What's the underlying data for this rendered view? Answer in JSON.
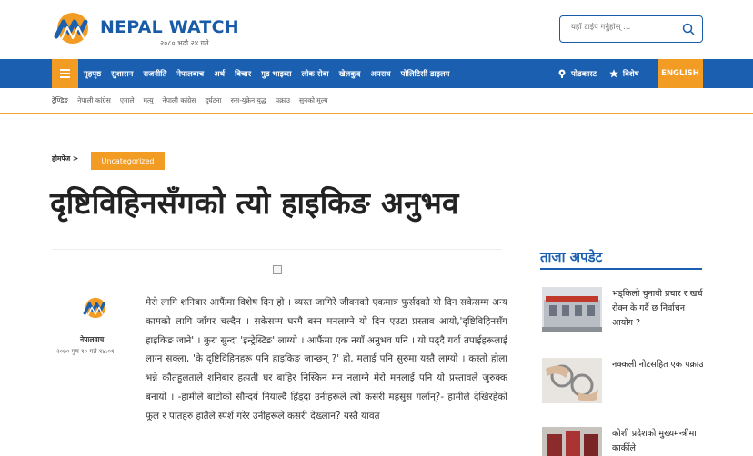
{
  "header": {
    "logo_text": "NEPAL WATCH",
    "date": "२०८० भदौ २४ गते",
    "search_placeholder": "यहाँ टाईप गर्नुहोस् ...",
    "colors": {
      "brand_blue": "#1b5fb0",
      "accent_orange": "#f39c24"
    }
  },
  "nav": {
    "items": [
      "गृहपृष्ठ",
      "सुशासन",
      "राजनीति",
      "नेपालवाच",
      "अर्थ",
      "विचार",
      "गुड भाइब्स",
      "लोक सेवा",
      "खेलकुद",
      "अपराध",
      "पोलिटिसीं डाइलग"
    ],
    "podcast": "पोडकास्ट",
    "special": "विशेष",
    "english": "ENGLISH",
    "icons": [
      "menu-icon",
      "podcast-icon",
      "star-icon",
      "search-icon"
    ]
  },
  "trending": [
    "ट्रेण्डिङ",
    "नेपाली कांग्रेस",
    "एमाले",
    "मृत्यु",
    "नेपाली कांग्रेस",
    "दुर्घटना",
    "रुस-युक्रेन युद्ध",
    "पक्राउ",
    "सुनको मूल्य"
  ],
  "breadcrumb": {
    "home": "होमपेज >",
    "category": "Uncategorized"
  },
  "article": {
    "title": "दृष्टिविहिनसँगको त्यो हाइकिङ अनुभव",
    "author": "नेपालवाच",
    "date": "२०७० पुष १० गते १४:०९",
    "body": "मेरो लागि शनिबार आफैंमा विशेष दिन हो । व्यस्त जागिरे जीवनको एकमात्र फुर्सदको यो दिन सकेसम्म अन्य कामको लागि जाँगर चल्दैन । सकेसम्म घरमै बस्न मनलाग्ने यो दिन एउटा प्रस्ताव आयो,'दृष्टिविहिनसँग हाइकिङ जाने' । कुरा सुन्दा 'इन्ट्रेस्टिङ' लाग्यो । आफैंमा एक नयाँ अनुभव पनि । यो पढ्दै गर्दा तपाईहरूलाई लाग्न सक्ला, 'के दृष्टिविहिनहरू पनि हाइकिङ जान्छन् ?' हो, मलाई पनि सुरुमा यस्तै लाग्यो । कस्तो होला भन्ने कौतहुलताले शनिबार हत्पती घर बाहिर निस्किन मन नलाग्ने मेरो मनलाई पनि यो प्रस्तावले जुरुक्क बनायो । -हामीले बाटोको सौन्दर्य नियाल्दै हिँड्दा उनीहरूले त्यो कसरी महसुस गर्लान्?- हामीले देखिरहेको फूल र पातहरु हातैले स्पर्श गरेर उनीहरूले कसरी देख्लान? यस्तै यावत"
  },
  "sidebar": {
    "title": "ताजा अपडेट",
    "items": [
      {
        "text": "भड्किलो चुनावी प्रचार र खर्च रोक्न के गर्दै छ निर्वाचन आयोग ?"
      },
      {
        "text": "नक्कली नोटसहित एक पक्राउ"
      },
      {
        "text": "कोशी प्रदेशको मुख्यमन्त्रीमा कार्कीले"
      }
    ]
  }
}
